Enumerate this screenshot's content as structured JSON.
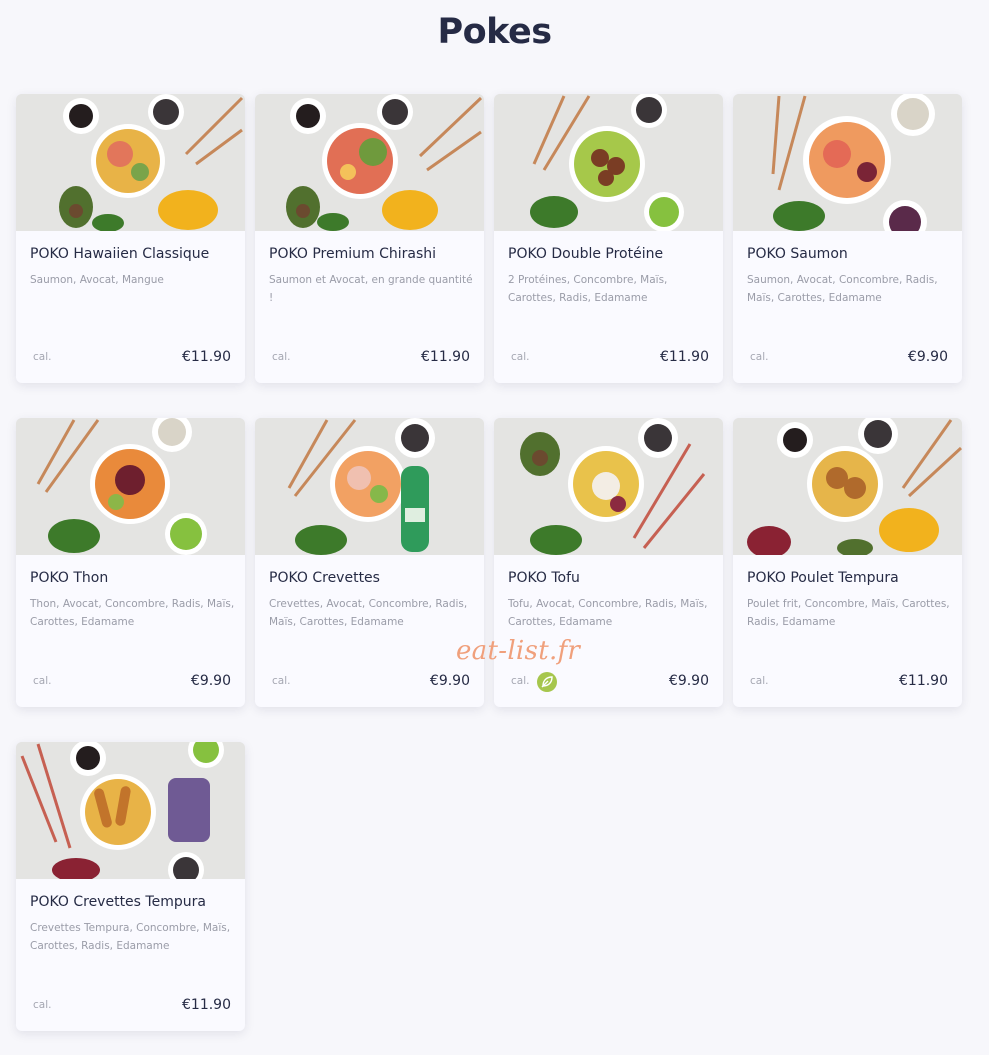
{
  "section": {
    "title": "Pokes"
  },
  "watermark": "eat-list.fr",
  "products": [
    {
      "name": "POKO Hawaiien Classique",
      "description": "Saumon, Avocat, Mangue",
      "cal": "cal.",
      "price": "€11.90",
      "photo": "poke-bowl-photo"
    },
    {
      "name": "POKO Premium Chirashi",
      "description": "Saumon et Avocat, en grande quantité !",
      "cal": "cal.",
      "price": "€11.90",
      "photo": "poke-bowl-photo"
    },
    {
      "name": "POKO Double Protéine",
      "description": "2 Protéines, Concombre, Maïs, Carottes, Radis, Edamame",
      "cal": "cal.",
      "price": "€11.90",
      "photo": "poke-bowl-photo"
    },
    {
      "name": "POKO Saumon",
      "description": "Saumon, Avocat, Concombre, Radis, Maïs, Carottes, Edamame",
      "cal": "cal.",
      "price": "€9.90",
      "photo": "poke-bowl-photo"
    },
    {
      "name": "POKO Thon",
      "description": "Thon, Avocat, Concombre, Radis, Maïs, Carottes, Edamame",
      "cal": "cal.",
      "price": "€9.90",
      "photo": "poke-bowl-photo"
    },
    {
      "name": "POKO Crevettes",
      "description": "Crevettes, Avocat, Concombre, Radis, Maïs, Carottes, Edamame",
      "cal": "cal.",
      "price": "€9.90",
      "photo": "poke-bowl-photo"
    },
    {
      "name": "POKO Tofu",
      "description": "Tofu, Avocat, Concombre, Radis, Maïs, Carottes, Edamame",
      "cal": "cal.",
      "price": "€9.90",
      "photo": "poke-bowl-photo",
      "vegetarian_icon": "leaf-icon"
    },
    {
      "name": "POKO Poulet Tempura",
      "description": "Poulet frit, Concombre, Maïs, Carottes, Radis, Edamame",
      "cal": "cal.",
      "price": "€11.90",
      "photo": "poke-bowl-photo"
    },
    {
      "name": "POKO Crevettes Tempura",
      "description": "Crevettes Tempura, Concombre, Maïs, Carottes, Radis, Edamame",
      "cal": "cal.",
      "price": "€11.90",
      "photo": "poke-bowl-photo"
    }
  ],
  "colors": {
    "title": "#262b45",
    "background": "#f7f7fb",
    "card": "#fafaff",
    "veg_badge": "#a6c64d",
    "watermark": "#f0a07c"
  }
}
